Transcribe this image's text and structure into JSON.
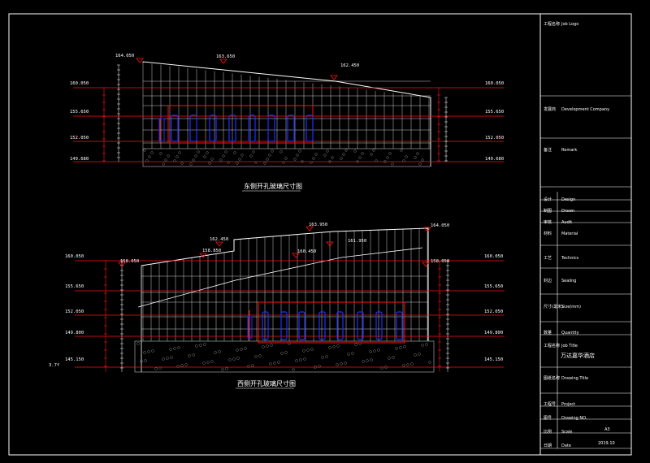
{
  "sheet": {
    "colors": {
      "background": "#000000",
      "border": "#ffffff",
      "red": "#ff1010",
      "blue": "#2030ff",
      "grid": "#c8c8c8"
    }
  },
  "east": {
    "title": "东侧开孔玻璃尺寸图",
    "peak_labels": [
      "164.050",
      "163.650",
      "162.450"
    ],
    "left_levels": [
      "160.050",
      "155.650",
      "152.050",
      "149.680"
    ],
    "right_levels": [
      "160.050",
      "155.650",
      "152.050",
      "149.680"
    ]
  },
  "west": {
    "title": "西侧开孔玻璃尺寸图",
    "top_labels": [
      "163.950",
      "164.050",
      "162.450",
      "161.950",
      "160.450",
      "158.850",
      "158.050",
      "158.050"
    ],
    "left_levels": [
      "160.050",
      "155.650",
      "152.050",
      "149.800",
      "145.150"
    ],
    "right_levels": [
      "160.050",
      "155.650",
      "152.050",
      "149.800",
      "145.150"
    ],
    "side_tag": "3.7f"
  },
  "titleblock": {
    "rows": [
      {
        "cn": "工程名称",
        "en": "Job Logo"
      },
      {
        "cn": "发展商",
        "en": "Development Company"
      },
      {
        "cn": "备注",
        "en": "Remark"
      },
      {
        "cn": "设计",
        "en": "Design"
      },
      {
        "cn": "制图",
        "en": "Drawn"
      },
      {
        "cn": "审核",
        "en": "Audit"
      },
      {
        "cn": "材料",
        "en": "Material"
      },
      {
        "cn": "工艺",
        "en": "Technics"
      },
      {
        "cn": "封边",
        "en": "Sealing"
      },
      {
        "cn": "尺寸(毫米)",
        "en": "Size(mm)"
      },
      {
        "cn": "数量",
        "en": "Quantity"
      },
      {
        "cn": "工程名称",
        "en": "Job Title"
      },
      {
        "cn": "图纸名称",
        "en": "Drawing Title"
      },
      {
        "cn": "工程号",
        "en": "Project"
      },
      {
        "cn": "图号",
        "en": "Drawing NO."
      },
      {
        "cn": "比例",
        "en": "Scale"
      },
      {
        "cn": "日期",
        "en": "Date"
      }
    ],
    "job_title_value": "万达嘉华酒店",
    "scale_value": "A3",
    "date_value": "2019.10"
  }
}
